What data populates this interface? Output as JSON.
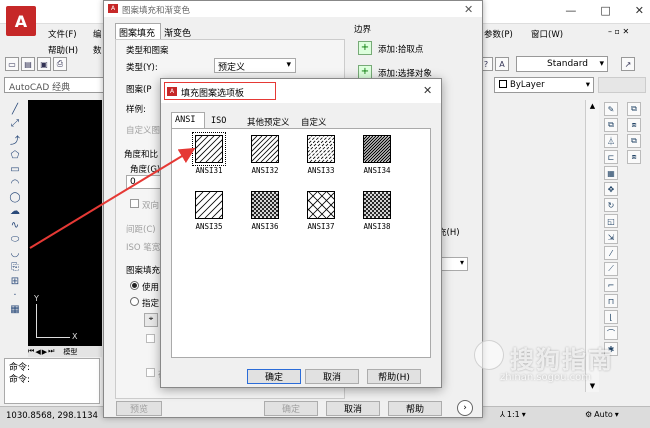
{
  "app": {
    "title_bar_suffix": "…",
    "menu_left": [
      "文件(F)",
      "编"
    ],
    "menu_left2": [
      "帮助(H)",
      "数"
    ],
    "menu_right": [
      "参数(P)",
      "窗口(W)"
    ],
    "window_controls": [
      "—",
      "□",
      "✕"
    ],
    "workspace": "AutoCAD 经典",
    "layer_combo": "ByLayer",
    "style_combo": "Standard",
    "model_tab": "模型",
    "command_lines": [
      "命令:",
      "命令:"
    ],
    "coords": "1030.8568, 298.1134",
    "annotation_scale": "1:1",
    "auto_label": "Auto"
  },
  "hatch_dialog": {
    "title": "图案填充和渐变色",
    "close": "✕",
    "tabs": [
      "图案填充",
      "渐变色"
    ],
    "type_group": "类型和图案",
    "type_label": "类型(Y):",
    "type_value": "预定义",
    "pattern_label": "图案(P",
    "sample_label": "样例:",
    "custom_label": "自定义图",
    "angle_group": "角度和比",
    "angle_label": "角度(G)",
    "angle_value": "0",
    "double_label": "双向",
    "spacing_label": "间距(C)",
    "iso_label": "ISO 笔宽",
    "origin_group": "图案填充",
    "use_label": "使用",
    "specify_label": "指定",
    "stored_label": "存",
    "boundary_title": "边界",
    "add_pick": "添加:拾取点",
    "add_select": "添加:选择对象",
    "side_suffix": "充(H)",
    "preview_btn": "预览",
    "ok_btn": "确定",
    "cancel_btn": "取消",
    "help_btn": "帮助"
  },
  "palette_dialog": {
    "title": "填充图案选项板",
    "close": "✕",
    "tabs": [
      "ANSI",
      "ISO",
      "其他预定义",
      "自定义"
    ],
    "patterns": [
      "ANSI31",
      "ANSI32",
      "ANSI33",
      "ANSI34",
      "ANSI35",
      "ANSI36",
      "ANSI37",
      "ANSI38"
    ],
    "ok": "确定",
    "cancel": "取消",
    "help": "帮助(H)"
  },
  "watermark": {
    "text": "搜狗指南",
    "url": "zhinan.sogou.com"
  },
  "colors": {
    "accent_red": "#e53935",
    "canvas_bg": "#000000"
  }
}
